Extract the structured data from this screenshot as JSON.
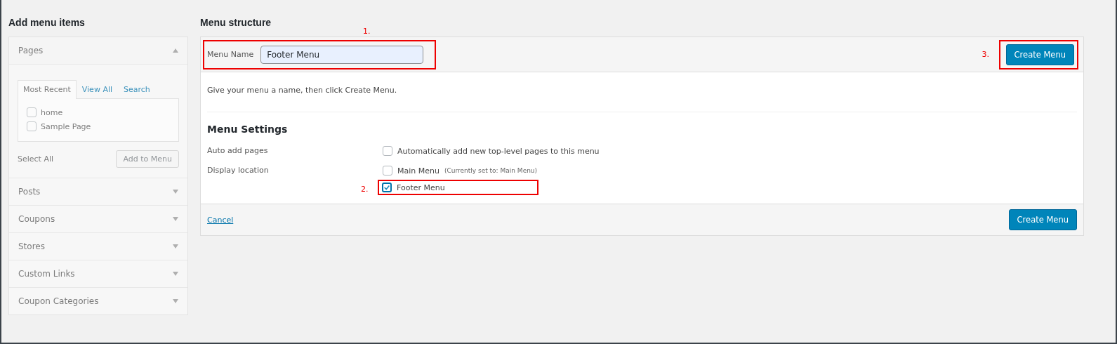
{
  "left": {
    "title": "Add menu items",
    "disabled": true,
    "sections": [
      {
        "title": "Pages",
        "expanded": true,
        "tabs": [
          {
            "label": "Most Recent",
            "selected": true
          },
          {
            "label": "View All",
            "selected": false
          },
          {
            "label": "Search",
            "selected": false
          }
        ],
        "items": [
          {
            "label": "home",
            "checked": false
          },
          {
            "label": "Sample Page",
            "checked": false
          }
        ],
        "select_all": "Select All",
        "add_button": "Add to Menu"
      },
      {
        "title": "Posts",
        "expanded": false
      },
      {
        "title": "Coupons",
        "expanded": false
      },
      {
        "title": "Stores",
        "expanded": false
      },
      {
        "title": "Custom Links",
        "expanded": false
      },
      {
        "title": "Coupon Categories",
        "expanded": false
      }
    ]
  },
  "right": {
    "title": "Menu structure",
    "menu_name": {
      "label": "Menu Name",
      "value": "Footer Menu",
      "annotation": "1."
    },
    "create_button": {
      "label": "Create Menu",
      "annotation": "3."
    },
    "hint": "Give your menu a name, then click Create Menu.",
    "settings_title": "Menu Settings",
    "settings": [
      {
        "label": "Auto add pages",
        "options": [
          {
            "label": "Automatically add new top-level pages to this menu",
            "checked": false
          }
        ]
      },
      {
        "label": "Display location",
        "options": [
          {
            "label": "Main Menu",
            "note": "(Currently set to: Main Menu)",
            "checked": false
          },
          {
            "label": "Footer Menu",
            "checked": true,
            "annotation": "2."
          }
        ]
      }
    ],
    "cancel": "Cancel",
    "footer_button": "Create Menu"
  }
}
